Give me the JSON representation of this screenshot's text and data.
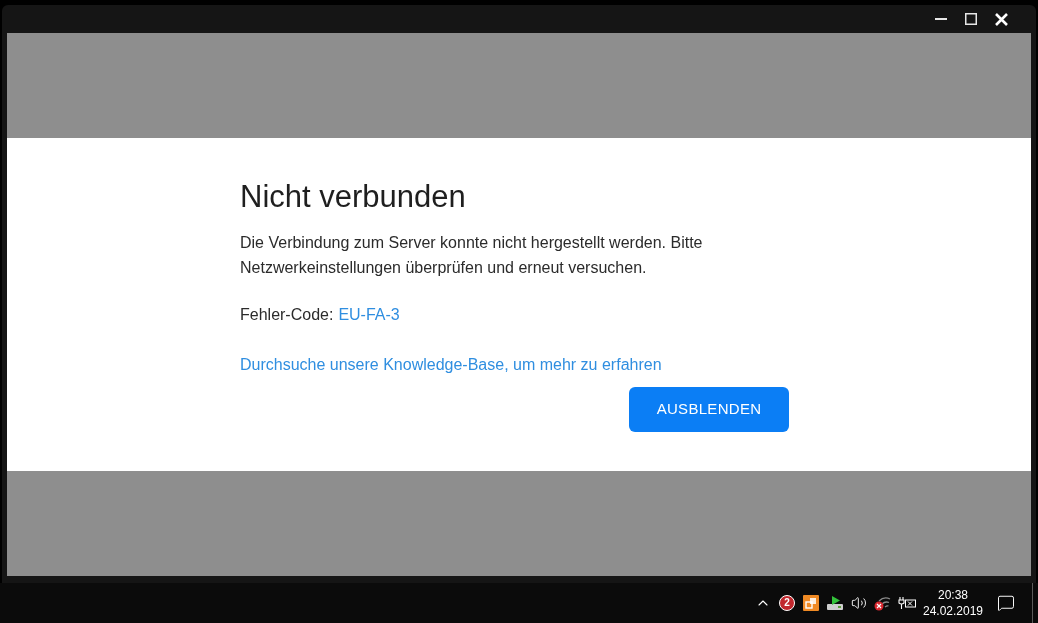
{
  "window": {
    "controls": [
      {
        "kind": "minimize"
      },
      {
        "kind": "maximize"
      },
      {
        "kind": "close"
      }
    ]
  },
  "dialog": {
    "title": "Nicht verbunden",
    "message": "Die Verbindung zum Server konnte nicht hergestellt werden. Bitte Netzwerkeinstellungen überprüfen und erneut versuchen.",
    "error_label": "Fehler-Code:",
    "error_code": "EU-FA-3",
    "help_link": "Durchsuche unsere Knowledge-Base, um mehr zu erfahren",
    "button": "AUSBLENDEN"
  },
  "taskbar": {
    "tray": [
      {
        "kind": "chevron"
      },
      {
        "kind": "badge",
        "label": "2"
      },
      {
        "kind": "app"
      },
      {
        "kind": "download"
      },
      {
        "kind": "volume"
      },
      {
        "kind": "wifi-off"
      },
      {
        "kind": "battery"
      }
    ],
    "time": "20:38",
    "date": "24.02.2019"
  }
}
